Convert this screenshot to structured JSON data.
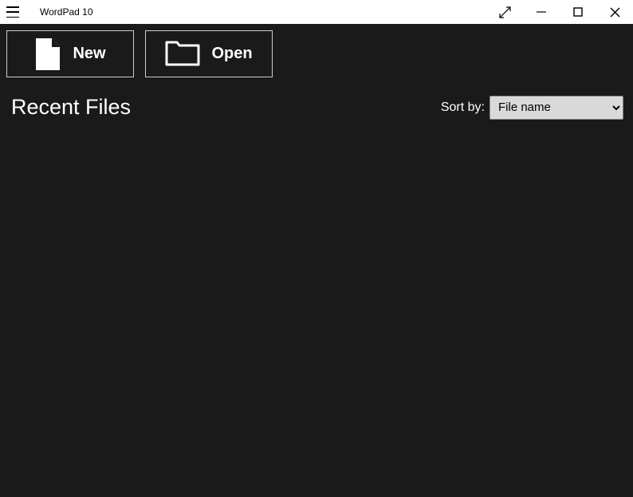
{
  "titlebar": {
    "app_title": "WordPad 10"
  },
  "actions": {
    "new_label": "New",
    "open_label": "Open"
  },
  "recent": {
    "heading": "Recent Files",
    "sort_label": "Sort by:",
    "sort_selected": "File name"
  }
}
